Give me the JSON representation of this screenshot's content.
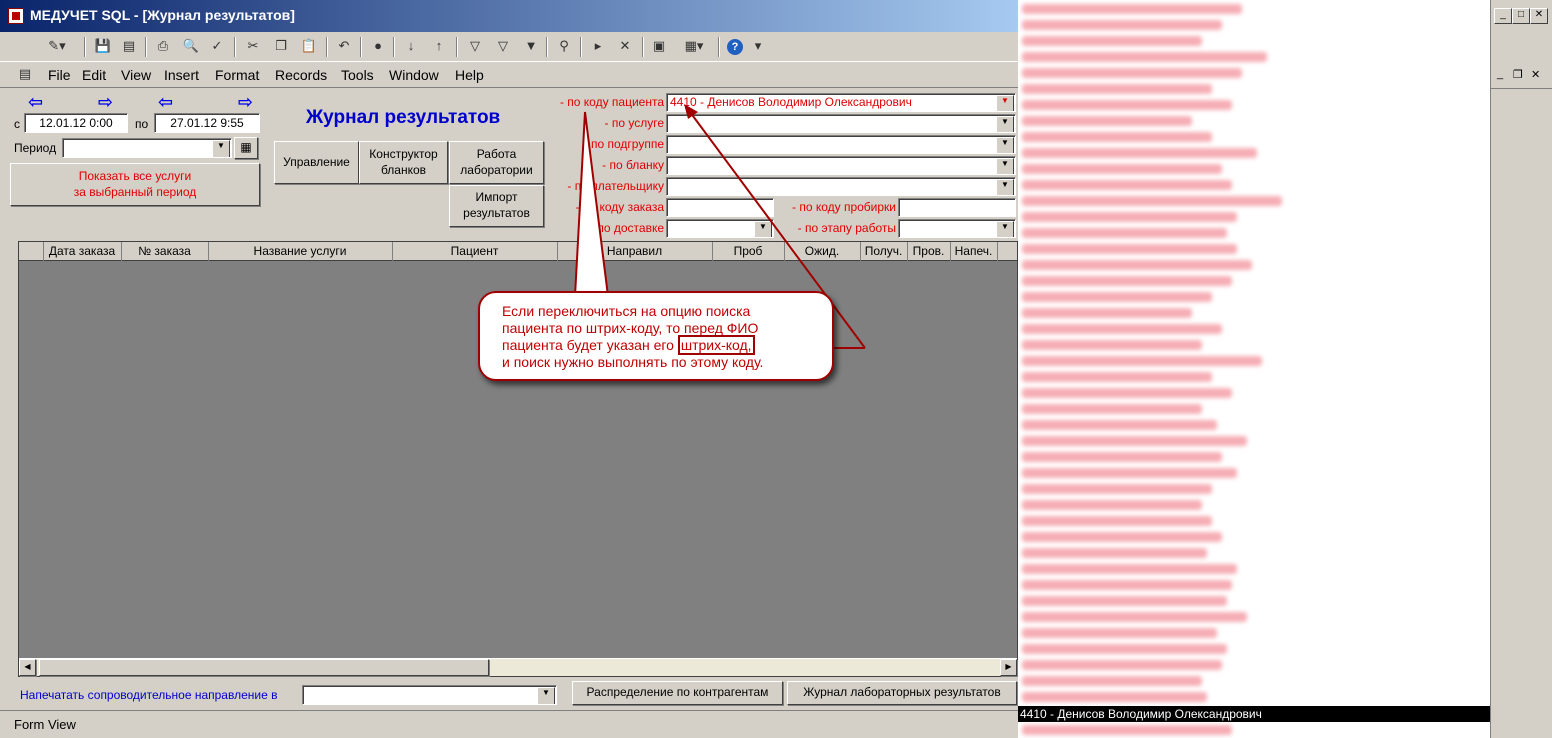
{
  "window": {
    "title": "МЕДУЧЕТ SQL - [Журнал результатов]"
  },
  "menu": {
    "items": [
      "File",
      "Edit",
      "View",
      "Insert",
      "Format",
      "Records",
      "Tools",
      "Window",
      "Help"
    ]
  },
  "period": {
    "from_prefix": "с",
    "from_value": "12.01.12 0:00",
    "to_prefix": "по",
    "to_value": "27.01.12 9:55",
    "label": "Период",
    "value": ""
  },
  "buttons": {
    "show_all_line1": "Показать все услуги",
    "show_all_line2": "за выбранный период",
    "management": "Управление",
    "designer_line1": "Конструктор",
    "designer_line2": "бланков",
    "lab_line1": "Работа",
    "lab_line2": "лаборатории",
    "import_line1": "Импорт",
    "import_line2": "результатов",
    "distribution": "Распределение по контрагентам",
    "lab_journal": "Журнал лабораторных результатов"
  },
  "form_title": "Журнал результатов",
  "filters": {
    "patient_label": "- по коду пациента",
    "patient_value": "4410 - Денисов Володимир Олександрович",
    "service_label": "- по услуге",
    "subgroup_label": "- по подгруппе",
    "blank_label": "- по бланку",
    "payer_label": "- по плательщику",
    "order_label": "- по коду заказа",
    "delivery_label": "- по доставке",
    "tube_label": "- по коду пробирки",
    "stage_label": "- по этапу работы"
  },
  "grid": {
    "columns": [
      "",
      "Дата заказа",
      "№ заказа",
      "Название услуги",
      "Пациент",
      "Направил",
      "Проб",
      "Ожид.",
      "Получ.",
      "Пров.",
      "Напеч."
    ]
  },
  "print_label": "Напечатать сопроводительное направление в",
  "callout": {
    "line1": "Если переключиться на опцию поиска",
    "line2": "пациента по штрих-коду, то перед ФИО",
    "line3a": "пациента будет указан его ",
    "line3b": "штрих-код,",
    "line4": "и поиск нужно выполнять по этому коду."
  },
  "status": {
    "text": "Form View"
  },
  "dropdown": {
    "selected": "4410 - Денисов Володимир Олександрович"
  },
  "colors": {
    "title_bar": "#0a246a",
    "label_red": "#e00000",
    "title_blue": "#0000cc",
    "callout_border": "#a00000",
    "grid_bg": "#808080"
  }
}
